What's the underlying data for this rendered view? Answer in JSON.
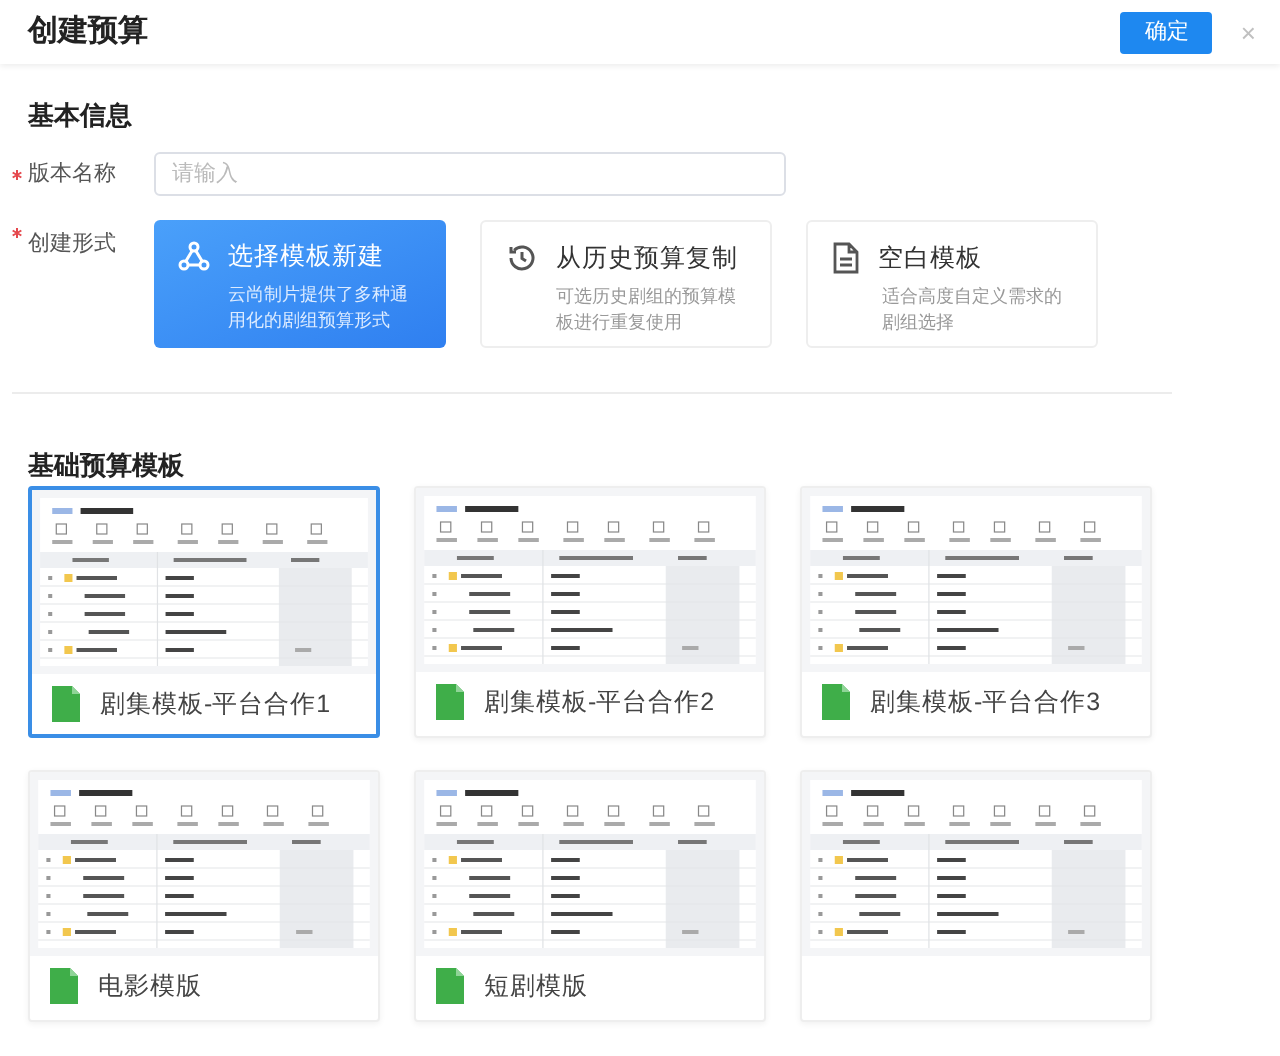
{
  "dialog": {
    "title": "创建预算",
    "confirm": "确定",
    "close": "×"
  },
  "basic_info": {
    "heading": "基本信息",
    "version_name": {
      "label": "版本名称",
      "required": true,
      "placeholder": "请输入"
    },
    "create_mode": {
      "label": "创建形式",
      "required": true,
      "options": [
        {
          "kind": "template",
          "title": "选择模板新建",
          "desc": "云尚制片提供了多种通用化的剧组预算形式",
          "selected": true
        },
        {
          "kind": "history",
          "title": "从历史预算复制",
          "desc": "可选历史剧组的预算模板进行重复使用",
          "selected": false
        },
        {
          "kind": "blank",
          "title": "空白模板",
          "desc": "适合高度自定义需求的剧组选择",
          "selected": false
        }
      ]
    }
  },
  "templates": {
    "heading": "基础预算模板",
    "items": [
      {
        "name": "剧集模板-平台合作1",
        "selected": true
      },
      {
        "name": "剧集模板-平台合作2",
        "selected": false
      },
      {
        "name": "剧集模板-平台合作3",
        "selected": false
      },
      {
        "name": "电影模版",
        "selected": false
      },
      {
        "name": "短剧模版",
        "selected": false
      },
      {
        "selected": false
      }
    ]
  }
}
